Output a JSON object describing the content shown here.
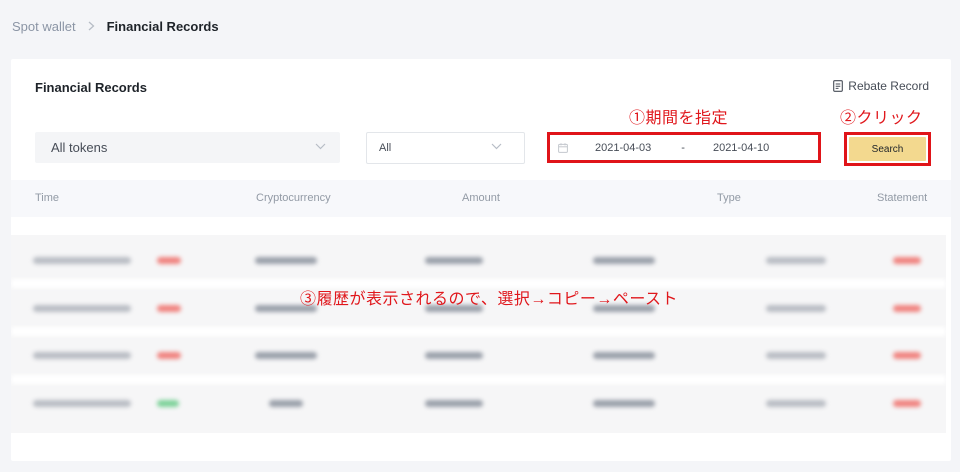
{
  "breadcrumb": {
    "parent": "Spot wallet",
    "current": "Financial Records",
    "separator_icon": "chevron-right-icon"
  },
  "panel": {
    "title": "Financial Records",
    "rebate_label": "Rebate Record",
    "rebate_icon": "document-icon"
  },
  "filters": {
    "token_select": {
      "value": "All tokens",
      "icon": "chevron-down-icon"
    },
    "type_select": {
      "value": "All",
      "icon": "chevron-down-icon"
    },
    "date_range": {
      "start": "2021-04-03",
      "separator": "-",
      "end": "2021-04-10",
      "icon": "calendar-icon"
    },
    "search_label": "Search"
  },
  "annotations": {
    "step1": "①期間を指定",
    "step2": "②クリック",
    "step3": "③履歴が表示されるので、選択→コピー→ペースト"
  },
  "table": {
    "columns": [
      "Time",
      "Cryptocurrency",
      "Amount",
      "Type",
      "Statement"
    ],
    "rows_blurred": true,
    "row_count": 4
  },
  "colors": {
    "annotation_red": "#e0171c",
    "search_button": "#f3d98f",
    "background": "#f4f5f8"
  }
}
